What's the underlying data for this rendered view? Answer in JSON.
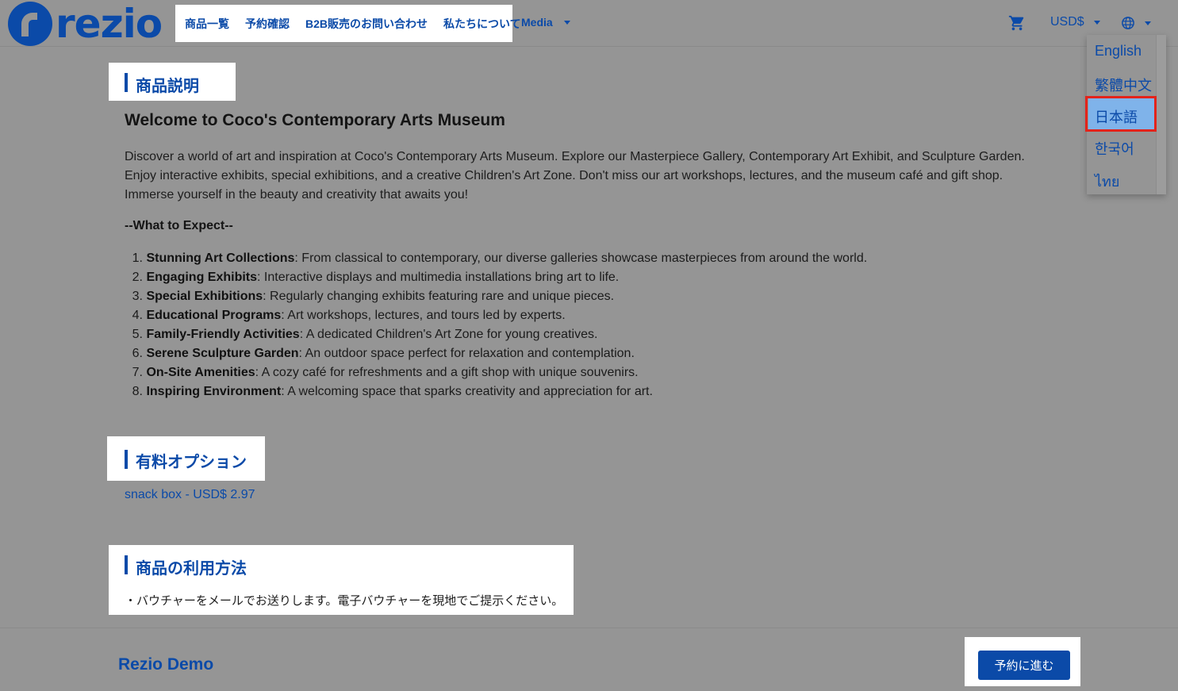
{
  "header": {
    "logo_text": "rezio",
    "nav": [
      "商品一覧",
      "予約確認",
      "B2B販売のお問い合わせ",
      "私たちについて"
    ],
    "media_label": "Media",
    "currency_label": "USD$"
  },
  "language_menu": {
    "items": [
      "English",
      "繁體中文",
      "日本語",
      "한국어",
      "ไทย"
    ],
    "selected": "日本語"
  },
  "sections": {
    "description_title": "商品説明",
    "options_title": "有料オプション",
    "usage_title": "商品の利用方法"
  },
  "content": {
    "welcome": "Welcome to Coco's Contemporary Arts Museum",
    "desc_line1": "Discover a world of art and inspiration at Coco's Contemporary Arts Museum. Explore our Masterpiece Gallery, Contemporary Art Exhibit, and Sculpture Garden.",
    "desc_line2": "Enjoy interactive exhibits, special exhibitions, and a creative Children's Art Zone. Don't miss our art workshops, lectures, and the museum café and gift shop.",
    "desc_line3": "Immerse yourself in the beauty and creativity that awaits you!",
    "expect_heading": "--What to Expect--",
    "list": [
      {
        "n": "1.",
        "b": "Stunning Art Collections",
        "t": ": From classical to contemporary, our diverse galleries showcase masterpieces from around the world."
      },
      {
        "n": "2.",
        "b": "Engaging Exhibits",
        "t": ": Interactive displays and multimedia installations bring art to life."
      },
      {
        "n": "3.",
        "b": "Special Exhibitions",
        "t": ": Regularly changing exhibits featuring rare and unique pieces."
      },
      {
        "n": "4.",
        "b": "Educational Programs",
        "t": ": Art workshops, lectures, and tours led by experts."
      },
      {
        "n": "5.",
        "b": "Family-Friendly Activities",
        "t": ": A dedicated Children's Art Zone for young creatives."
      },
      {
        "n": "6.",
        "b": "Serene Sculpture Garden",
        "t": ": An outdoor space perfect for relaxation and contemplation."
      },
      {
        "n": "7.",
        "b": "On-Site Amenities",
        "t": ": A cozy café for refreshments and a gift shop with unique souvenirs."
      },
      {
        "n": "8.",
        "b": "Inspiring Environment",
        "t": ": A welcoming space that sparks creativity and appreciation for art."
      }
    ],
    "snack_option": "snack box - USD$ 2.97",
    "voucher_note": "・バウチャーをメールでお送りします。電子バウチャーを現地でご提示ください。"
  },
  "footer": {
    "brand": "Rezio Demo",
    "book_button": "予約に進む"
  },
  "colors": {
    "accent": "#0b4aa8",
    "overlay_bg": "#959595",
    "highlight_outline": "#e3231b",
    "selected_bg": "#7fb3ea"
  }
}
